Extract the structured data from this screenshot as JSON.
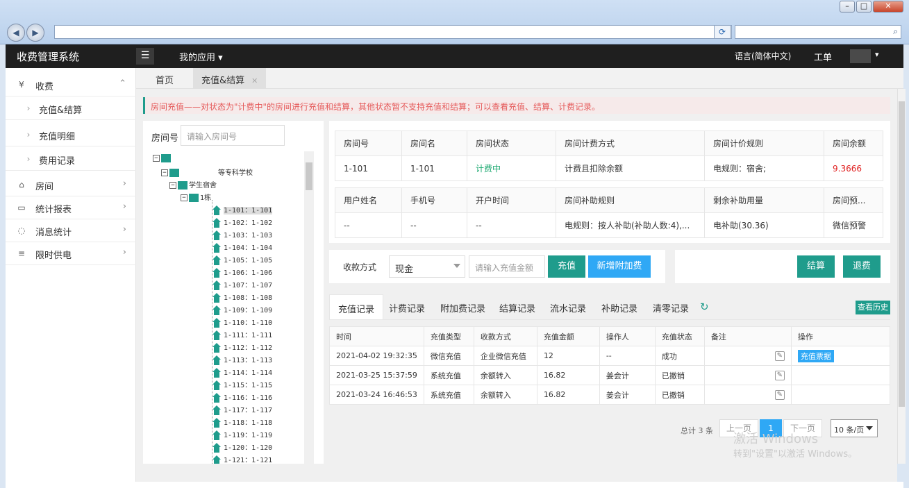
{
  "app": {
    "title": "收费管理系统",
    "my_apps": "我的应用",
    "language": "语言(简体中文)",
    "ticket": "工单"
  },
  "sidebar": {
    "items": [
      {
        "label": "收费",
        "icon": "yen-icon"
      },
      {
        "label": "充值&结算"
      },
      {
        "label": "充值明细"
      },
      {
        "label": "费用记录"
      },
      {
        "label": "房间",
        "icon": "home-icon"
      },
      {
        "label": "统计报表",
        "icon": "monitor-icon"
      },
      {
        "label": "消息统计",
        "icon": "message-icon"
      },
      {
        "label": "限时供电",
        "icon": "sliders-icon"
      }
    ]
  },
  "tabs": [
    {
      "label": "首页"
    },
    {
      "label": "充值&结算"
    }
  ],
  "notice": "房间充值——对状态为\"计费中\"的房间进行充值和结算，其他状态暂不支持充值和结算；可以查看充值、结算、计费记录。",
  "room_search": {
    "label": "房间号",
    "placeholder": "请输入房间号"
  },
  "tree": {
    "school": "等专科学校",
    "dorm": "学生宿舍",
    "building": "1栋",
    "rooms": [
      "1-101：1-101",
      "1-102：1-102",
      "1-103：1-103",
      "1-104：1-104",
      "1-105：1-105",
      "1-106：1-106",
      "1-107：1-107",
      "1-108：1-108",
      "1-109：1-109",
      "1-110：1-110",
      "1-111：1-111",
      "1-112：1-112",
      "1-113：1-113",
      "1-114：1-114",
      "1-115：1-115",
      "1-116：1-116",
      "1-117：1-117",
      "1-118：1-118",
      "1-119：1-119",
      "1-120：1-120",
      "1-121：1-121"
    ]
  },
  "room_info": {
    "headers1": [
      "房间号",
      "房间名",
      "房间状态",
      "房间计费方式",
      "房间计价规则",
      "房间余额"
    ],
    "values1": [
      "1-101",
      "1-101",
      "计费中",
      "计费且扣除余额",
      "电规则：宿舍;",
      "9.3666"
    ],
    "headers2": [
      "用户姓名",
      "手机号",
      "开户时间",
      "房间补助规则",
      "剩余补助用量",
      "房间预..."
    ],
    "values2": [
      "--",
      "--",
      "--",
      "电规则：按人补助(补助人数:4),...",
      "电补助(30.36)",
      "微信预警"
    ]
  },
  "payment": {
    "label": "收款方式",
    "method": "现金",
    "amount_placeholder": "请输入充值金额",
    "recharge_btn": "充值",
    "add_fee_btn": "新增附加费",
    "settle_btn": "结算",
    "refund_btn": "退费"
  },
  "record_tabs": [
    "充值记录",
    "计费记录",
    "附加费记录",
    "结算记录",
    "流水记录",
    "补助记录",
    "清零记录"
  ],
  "history_btn": "查看历史",
  "records": {
    "headers": [
      "时间",
      "充值类型",
      "收款方式",
      "充值金额",
      "操作人",
      "充值状态",
      "备注",
      "操作"
    ],
    "rows": [
      [
        "2021-04-02 19:32:35",
        "微信充值",
        "企业微信充值",
        "12",
        "--",
        "成功",
        "",
        "充值票据"
      ],
      [
        "2021-03-25 15:37:59",
        "系统充值",
        "余额转入",
        "16.82",
        "姜会计",
        "已撤销",
        "",
        ""
      ],
      [
        "2021-03-24 16:46:53",
        "系统充值",
        "余额转入",
        "16.82",
        "姜会计",
        "已撤销",
        "",
        ""
      ]
    ]
  },
  "pager": {
    "total": "总计 3 条",
    "prev": "上一页",
    "current": "1",
    "next": "下一页",
    "page_size": "10 条/页"
  },
  "watermark": {
    "line1": "激活 Windows",
    "line2": "转到\"设置\"以激活 Windows。"
  },
  "colors": {
    "accent": "#1f9c8c",
    "blue": "#2fa8f5",
    "danger": "#e02020",
    "status_green": "#1aa86f"
  }
}
